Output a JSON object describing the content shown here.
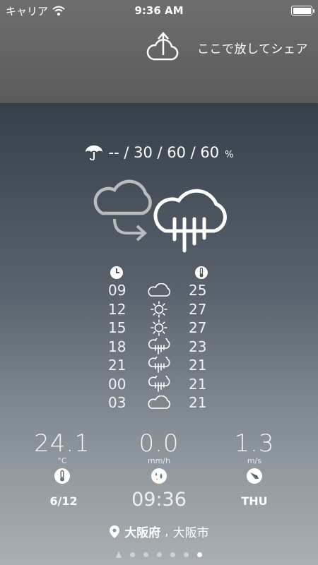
{
  "status_bar": {
    "carrier": "キャリア",
    "time": "9:36 AM"
  },
  "share": {
    "label": "ここで放してシェア"
  },
  "precipitation": {
    "values": "-- / 30 / 60 / 60",
    "unit": "%"
  },
  "hourly": [
    {
      "hour": "09",
      "icon": "cloud-icon",
      "temp": "25"
    },
    {
      "hour": "12",
      "icon": "sun-icon",
      "temp": "27"
    },
    {
      "hour": "15",
      "icon": "sun-icon",
      "temp": "27"
    },
    {
      "hour": "18",
      "icon": "rain-cloud-icon",
      "temp": "23"
    },
    {
      "hour": "21",
      "icon": "rain-cloud-icon",
      "temp": "21"
    },
    {
      "hour": "00",
      "icon": "rain-cloud-icon",
      "temp": "21"
    },
    {
      "hour": "03",
      "icon": "cloud-icon",
      "temp": "21"
    }
  ],
  "stats": {
    "temperature": {
      "value": "24.1",
      "unit": "°C"
    },
    "rainfall": {
      "value": "0.0",
      "unit": "mm/h"
    },
    "wind": {
      "value": "1.3",
      "unit": "m/s"
    }
  },
  "info": {
    "date": "6/12",
    "clock": "09:36",
    "weekday": "THU"
  },
  "location": {
    "prefecture": "大阪府",
    "separator": ",",
    "city": "大阪市"
  },
  "pager": {
    "count": 6,
    "active_index": 5
  }
}
